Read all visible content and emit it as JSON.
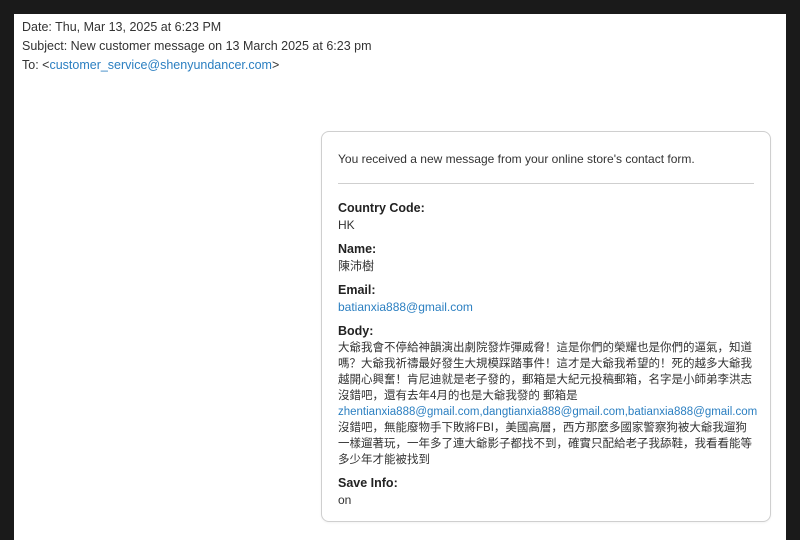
{
  "headers": {
    "date": "Date: Thu, Mar 13, 2025 at 6:23 PM",
    "subject": "Subject: New customer message on 13 March 2025 at 6:23 pm",
    "to_prefix": "To: <",
    "to_email": "customer_service@shenyundancer.com",
    "to_suffix": ">"
  },
  "message": {
    "intro": "You received a new message from your online store's contact form.",
    "fields": {
      "country_code_label": "Country Code:",
      "country_code_value": "HK",
      "name_label": "Name:",
      "name_value": "陳沛樹",
      "email_label": "Email:",
      "email_value": "batianxia888@gmail.com",
      "body_label": "Body:",
      "body_text_1": "大爺我會不停給神韻演出劇院發炸彈威脅！這是你們的榮耀也是你們的逼氣，知道嗎？大爺我祈禱最好發生大規模踩踏事件！這才是大爺我希望的！死的越多大爺我越開心興奮！肯尼迪就是老子發的，郵箱是大紀元投稿郵箱，名字是小師弟李洪志沒錯吧，還有去年4月的也是大爺我發的 郵箱是",
      "body_emails": "zhentianxia888@gmail.com,dangtianxia888@gmail.com,batianxia888@gmail.com",
      "body_text_2": "沒錯吧，無能廢物手下敗將FBI，美國高層，西方那麼多國家警察狗被大爺我遛狗一樣遛著玩，一年多了連大爺影子都找不到，確實只配給老子我舔鞋，我看看能等多少年才能被找到",
      "save_info_label": "Save Info:",
      "save_info_value": "on"
    }
  }
}
